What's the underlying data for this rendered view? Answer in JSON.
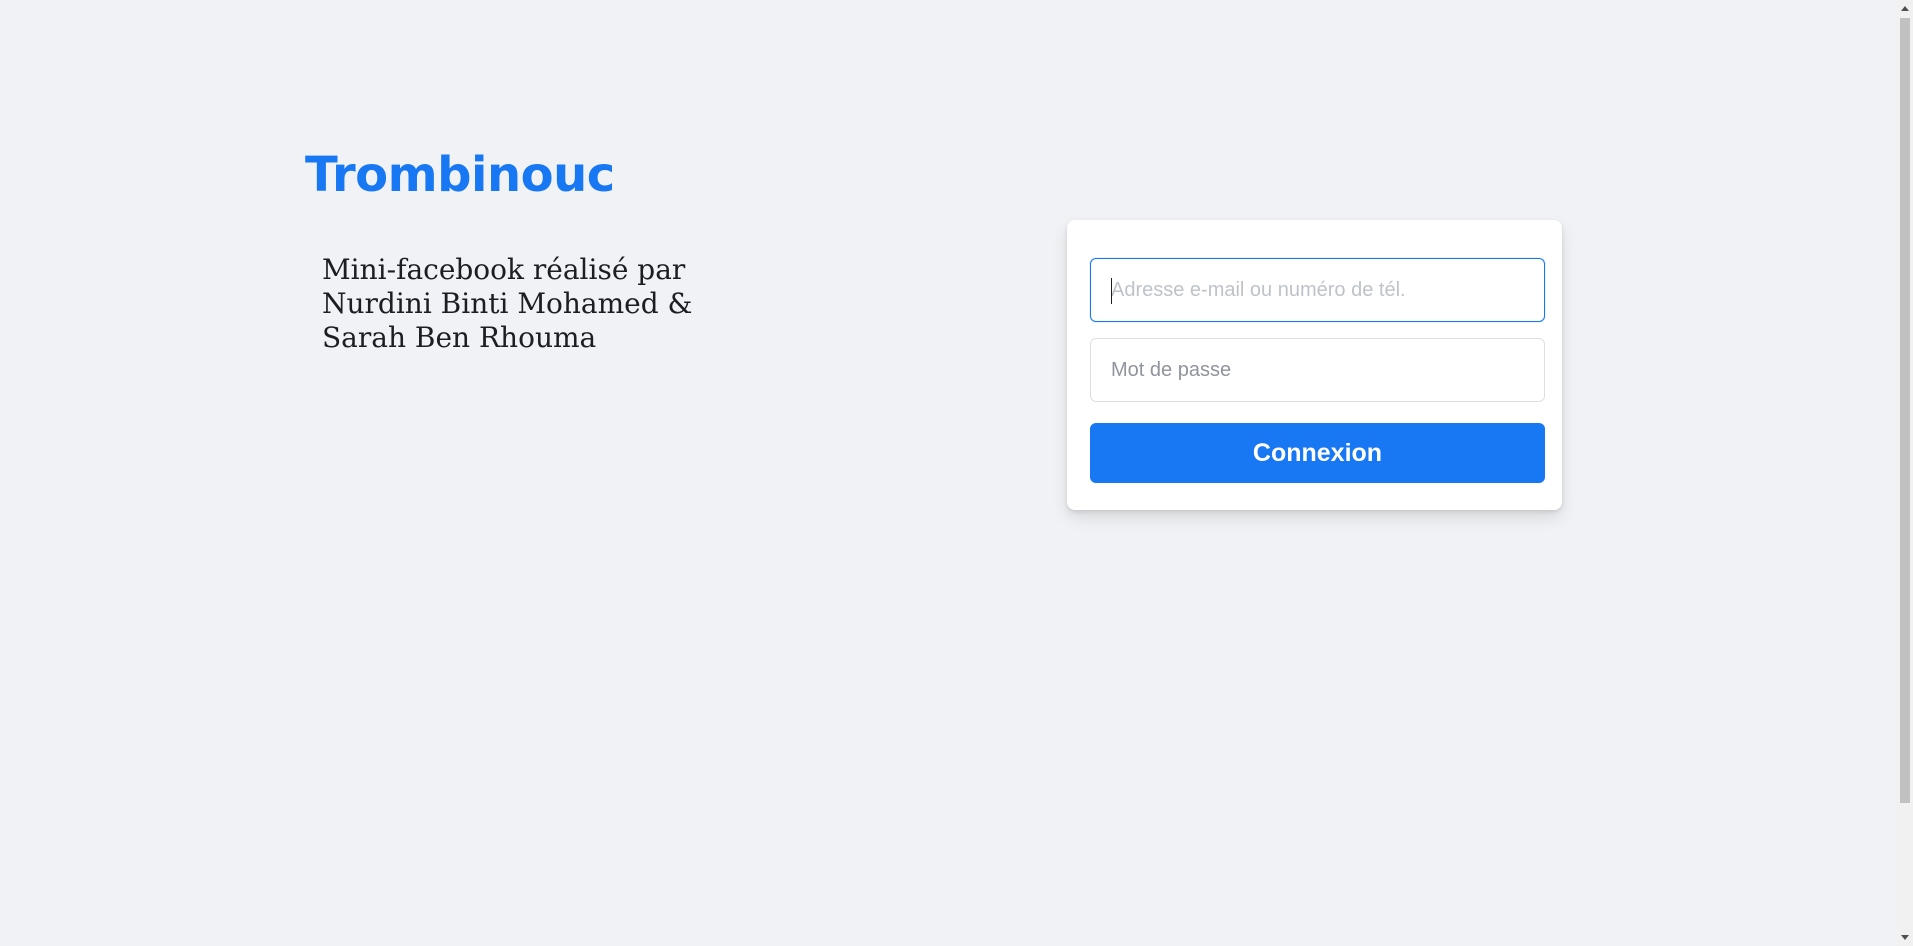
{
  "brand": {
    "title": "Trombinouc",
    "tagline": "Mini-facebook réalisé par Nurdini Binti Mohamed & Sarah Ben Rhouma",
    "accent_color": "#1877f2"
  },
  "login": {
    "email_placeholder": "Adresse e-mail ou numéro de tél.",
    "email_value": "",
    "password_placeholder": "Mot de passe",
    "password_value": "",
    "submit_label": "Connexion"
  },
  "icons": {
    "scroll_up": "chevron-up-icon",
    "scroll_down": "chevron-down-icon"
  }
}
